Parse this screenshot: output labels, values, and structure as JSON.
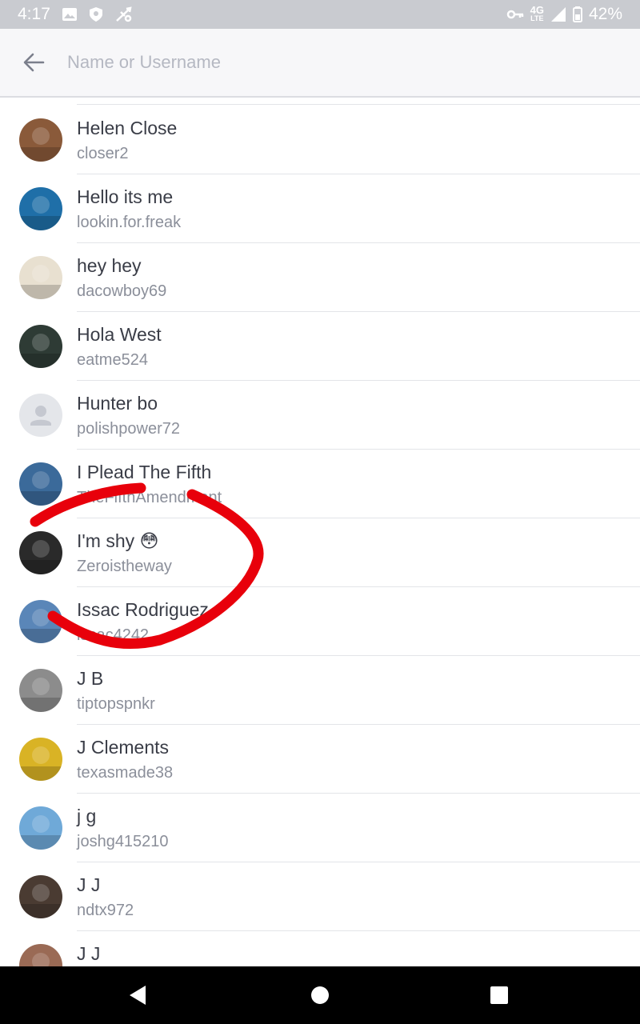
{
  "status_bar": {
    "time": "4:17",
    "network": "4G",
    "network_sub": "LTE",
    "battery": "42%",
    "icons": [
      "image-icon",
      "shield-icon",
      "usb-icon",
      "key-icon",
      "signal-icon",
      "battery-icon"
    ]
  },
  "search": {
    "placeholder": "Name or Username",
    "value": ""
  },
  "contacts": [
    {
      "name": "Helen Close",
      "username": "closer2",
      "avatar_color": "#8a5a3a"
    },
    {
      "name": "Hello its me",
      "username": "lookin.for.freak",
      "avatar_color": "#1f6fa8"
    },
    {
      "name": "hey hey",
      "username": "dacowboy69",
      "avatar_color": "#e8e0d0"
    },
    {
      "name": "Hola West",
      "username": "eatme524",
      "avatar_color": "#2e3b35"
    },
    {
      "name": "Hunter bo",
      "username": "polishpower72",
      "avatar_color": "#e4e6ea"
    },
    {
      "name": "I Plead The Fifth",
      "username": "TheFifthAmendment",
      "avatar_color": "#3b6a9a"
    },
    {
      "name": "I'm shy 😳",
      "username": "Zeroistheway",
      "avatar_color": "#2a2a2a"
    },
    {
      "name": "Issac Rodriguez",
      "username": "issac4242",
      "avatar_color": "#5a86b8"
    },
    {
      "name": "J B",
      "username": "tiptopspnkr",
      "avatar_color": "#8c8c8c"
    },
    {
      "name": "J Clements",
      "username": "texasmade38",
      "avatar_color": "#d9b325"
    },
    {
      "name": "j g",
      "username": "joshg415210",
      "avatar_color": "#6fa9d8"
    },
    {
      "name": "J J",
      "username": "ndtx972",
      "avatar_color": "#4a3b32"
    },
    {
      "name": "J J",
      "username": "",
      "avatar_color": "#9a6a55"
    }
  ],
  "annotation": {
    "color": "#e8000b"
  },
  "nav": {
    "icons": [
      "back-triangle-icon",
      "home-circle-icon",
      "recents-square-icon"
    ]
  }
}
